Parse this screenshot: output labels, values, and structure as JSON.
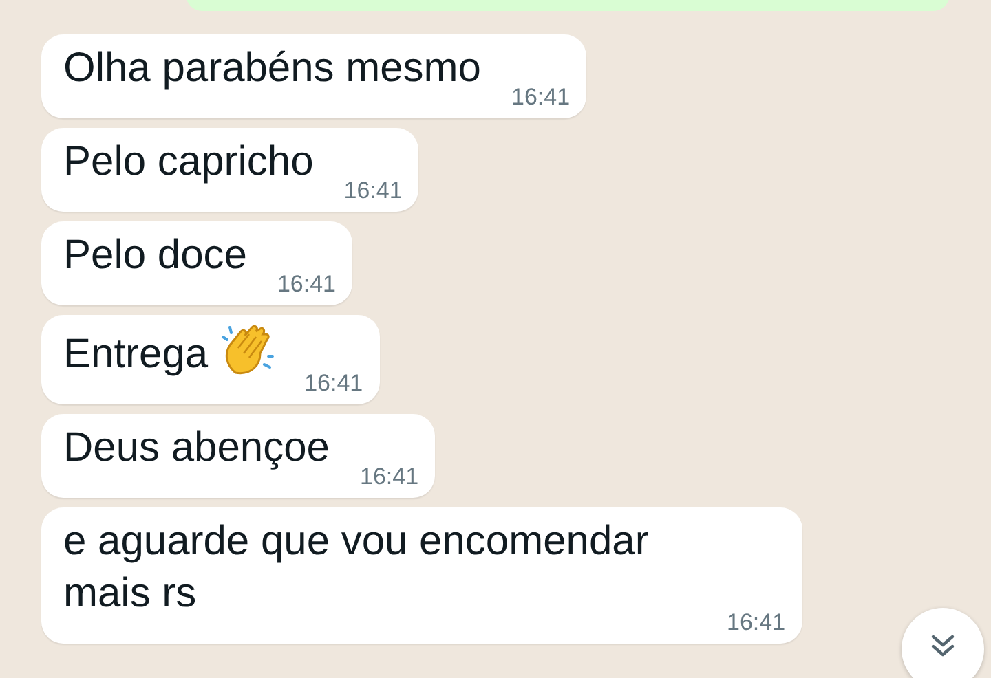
{
  "messages": [
    {
      "text": "Olha parabéns mesmo",
      "time": "16:41",
      "has_icon": false
    },
    {
      "text": "Pelo capricho",
      "time": "16:41",
      "has_icon": false
    },
    {
      "text": "Pelo doce",
      "time": "16:41",
      "has_icon": false
    },
    {
      "text": "Entrega",
      "time": "16:41",
      "has_icon": true
    },
    {
      "text": "Deus abençoe",
      "time": "16:41",
      "has_icon": false
    },
    {
      "text": "e aguarde que vou encomendar mais rs",
      "time": "16:41",
      "has_icon": false
    }
  ]
}
